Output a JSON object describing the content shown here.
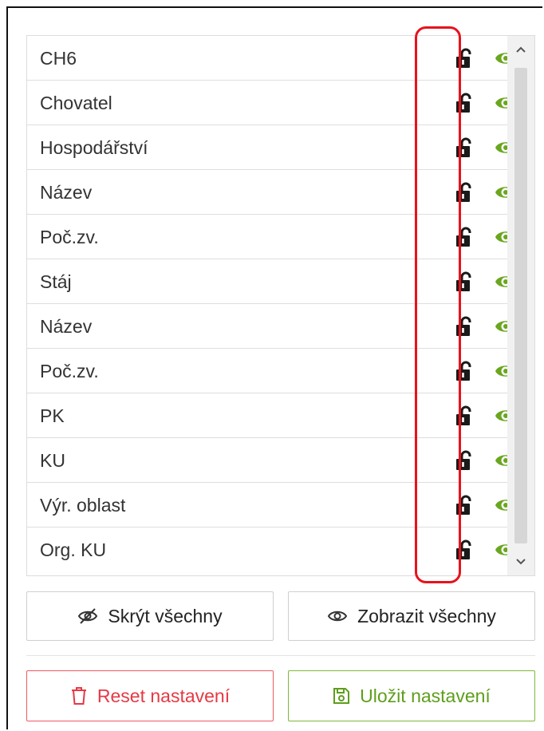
{
  "columns": [
    {
      "label": "CH6",
      "locked": false,
      "visible": true
    },
    {
      "label": "Chovatel",
      "locked": false,
      "visible": true
    },
    {
      "label": "Hospodářství",
      "locked": false,
      "visible": true
    },
    {
      "label": "Název",
      "locked": false,
      "visible": true
    },
    {
      "label": "Poč.zv.",
      "locked": false,
      "visible": true
    },
    {
      "label": "Stáj",
      "locked": false,
      "visible": true
    },
    {
      "label": "Název",
      "locked": false,
      "visible": true
    },
    {
      "label": "Poč.zv.",
      "locked": false,
      "visible": true
    },
    {
      "label": "PK",
      "locked": false,
      "visible": true
    },
    {
      "label": "KU",
      "locked": false,
      "visible": true
    },
    {
      "label": "Výr. oblast",
      "locked": false,
      "visible": true
    },
    {
      "label": "Org. KU",
      "locked": false,
      "visible": true
    }
  ],
  "actions": {
    "hide_all_label": "Skrýt všechny",
    "show_all_label": "Zobrazit všechny",
    "reset_label": "Reset nastavení",
    "save_label": "Uložit nastavení"
  },
  "icons": {
    "row_lock": "unlocked-padlock-icon",
    "row_visibility": "eye-icon",
    "hide_all": "eye-slash-icon",
    "show_all": "eye-outline-icon",
    "reset": "trash-icon",
    "save": "floppy-disk-icon"
  },
  "colors": {
    "eye_green": "#6aa61f",
    "reset_red": "#e43a44",
    "save_green": "#5e9e1c",
    "highlight_red": "#e8121c"
  }
}
